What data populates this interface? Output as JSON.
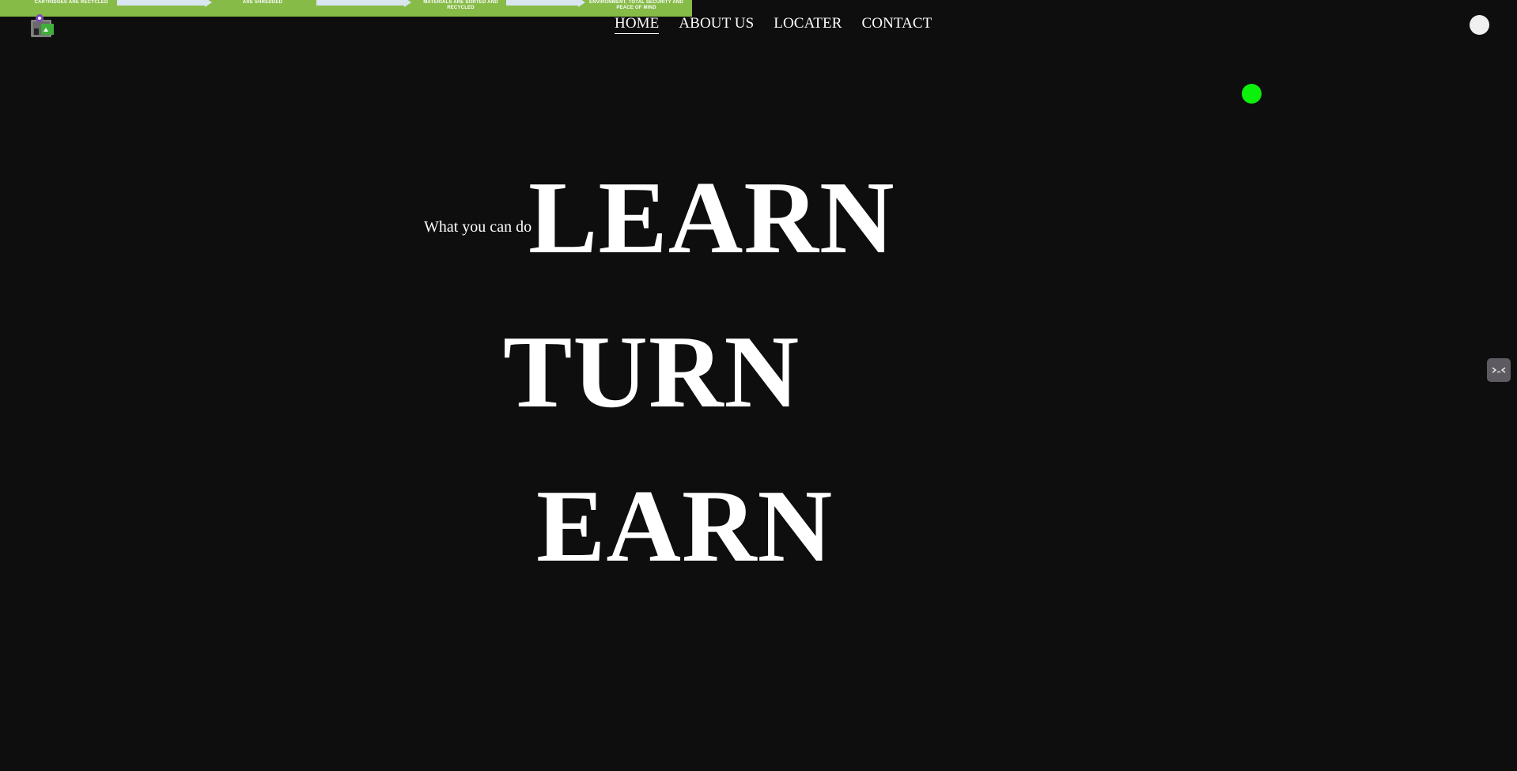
{
  "banner": {
    "items": [
      "CARTRIDGES ARE RECYCLED",
      "ARE SHREDDED",
      "MATERIALS ARE SORTED AND RECYCLED",
      "ENVIRONMENT, TOTAL SECURITY AND PEACE OF MIND"
    ],
    "color": "#86bb47"
  },
  "logo": {
    "icon": "recycling-bin-logo-icon"
  },
  "nav": {
    "items": [
      {
        "label": "HOME",
        "active": true
      },
      {
        "label": "ABOUT US",
        "active": false
      },
      {
        "label": "LOCATER",
        "active": false
      },
      {
        "label": "CONTACT",
        "active": false
      }
    ]
  },
  "controls": {
    "theme_toggle_icon": "circle-toggle-icon",
    "status_indicator_color": "#0cf10c",
    "side_tab_icon": "chat-widget-icon"
  },
  "hero": {
    "tagline": "What you can do",
    "words": [
      "LEARN",
      "TURN",
      "EARN"
    ]
  },
  "colors": {
    "background": "#0f0e0f",
    "text": "#ffffff"
  }
}
